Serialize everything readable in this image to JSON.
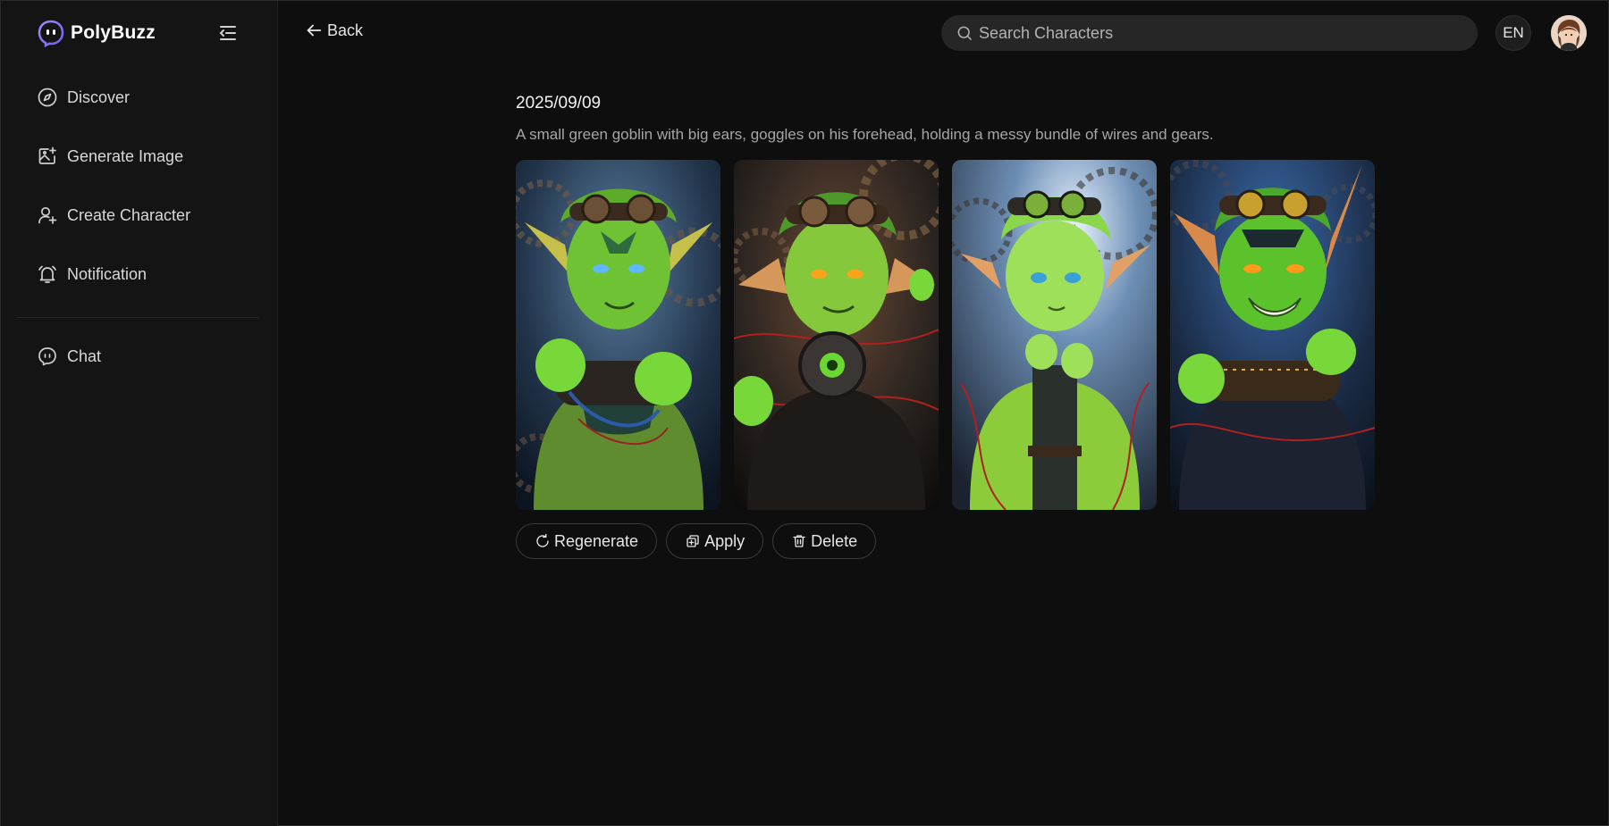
{
  "brand": {
    "name": "PolyBuzz"
  },
  "sidebar": {
    "items": [
      {
        "label": "Discover",
        "icon": "compass-icon"
      },
      {
        "label": "Generate Image",
        "icon": "image-plus-icon"
      },
      {
        "label": "Create Character",
        "icon": "user-plus-icon"
      },
      {
        "label": "Notification",
        "icon": "bell-icon"
      }
    ],
    "chat": {
      "label": "Chat",
      "icon": "chat-bubble-icon"
    }
  },
  "header": {
    "back_label": "Back",
    "search_placeholder": "Search Characters",
    "search_value": "",
    "language": "EN"
  },
  "result": {
    "date": "2025/09/09",
    "prompt": "A small green goblin with big ears, goggles on his forehead, holding a messy bundle of wires and gears.",
    "images": [
      {
        "name": "goblin-image-1"
      },
      {
        "name": "goblin-image-2"
      },
      {
        "name": "goblin-image-3"
      },
      {
        "name": "goblin-image-4"
      }
    ]
  },
  "actions": {
    "regenerate_label": "Regenerate",
    "apply_label": "Apply",
    "delete_label": "Delete"
  },
  "colors": {
    "background": "#0e0e0e",
    "sidebar": "#141414",
    "search_bg": "#262626",
    "accent_logo": "#8b7cf6",
    "goblin_green": "#7ccf3a"
  }
}
